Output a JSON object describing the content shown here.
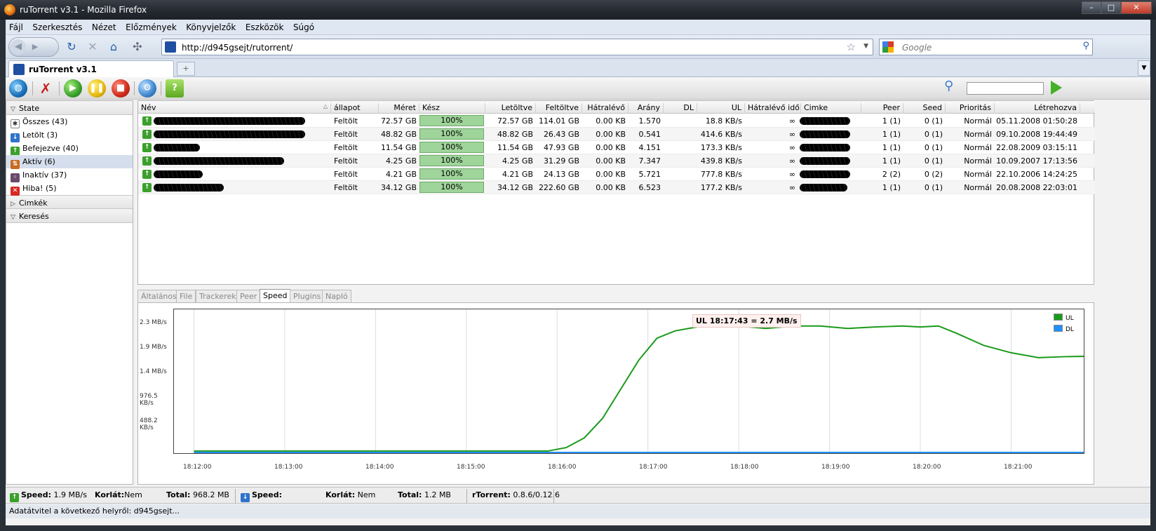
{
  "window": {
    "title": "ruTorrent v3.1 - Mozilla Firefox"
  },
  "menu": [
    "Fájl",
    "Szerkesztés",
    "Nézet",
    "Előzmények",
    "Könyvjelzők",
    "Eszközök",
    "Súgó"
  ],
  "nav": {
    "url": "http://d945gsejt/rutorrent/",
    "search_placeholder": "Google"
  },
  "browser_tab": {
    "label": "ruTorrent v3.1",
    "new_tab": "+"
  },
  "sidebar": {
    "state_header": "State",
    "items": [
      {
        "label": "Összes (43)",
        "icon": "all-icon"
      },
      {
        "label": "Letölt (3)",
        "icon": "download-icon"
      },
      {
        "label": "Befejezve (40)",
        "icon": "completed-icon"
      },
      {
        "label": "Aktív (6)",
        "icon": "active-icon"
      },
      {
        "label": "Inaktív (37)",
        "icon": "inactive-icon"
      },
      {
        "label": "Hiba! (5)",
        "icon": "error-icon"
      }
    ],
    "labels_header": "Cimkék",
    "search_header": "Keresés"
  },
  "list": {
    "columns": [
      "Név",
      "állapot",
      "Méret",
      "Kész",
      "Letöltve",
      "Feltöltve",
      "Hátralévő",
      "Arány",
      "DL",
      "UL",
      "Hátralévő idő",
      "Cimke",
      "Peer",
      "Seed",
      "Prioritás",
      "Létrehozva"
    ],
    "rows": [
      {
        "status": "Feltölt",
        "size": "72.57 GB",
        "done": "100%",
        "downloaded": "72.57 GB",
        "uploaded": "114.01 GB",
        "remaining": "0.00 KB",
        "ratio": "1.570",
        "dl": "",
        "ul": "18.8 KB/s",
        "eta": "∞",
        "peer": "1 (1)",
        "seed": "0 (1)",
        "priority": "Normál",
        "created": "05.11.2008 01:50:28"
      },
      {
        "status": "Feltölt",
        "size": "48.82 GB",
        "done": "100%",
        "downloaded": "48.82 GB",
        "uploaded": "26.43 GB",
        "remaining": "0.00 KB",
        "ratio": "0.541",
        "dl": "",
        "ul": "414.6 KB/s",
        "eta": "∞",
        "peer": "1 (1)",
        "seed": "0 (1)",
        "priority": "Normál",
        "created": "09.10.2008 19:44:49"
      },
      {
        "status": "Feltölt",
        "size": "11.54 GB",
        "done": "100%",
        "downloaded": "11.54 GB",
        "uploaded": "47.93 GB",
        "remaining": "0.00 KB",
        "ratio": "4.151",
        "dl": "",
        "ul": "173.3 KB/s",
        "eta": "∞",
        "peer": "1 (1)",
        "seed": "0 (1)",
        "priority": "Normál",
        "created": "22.08.2009 03:15:11"
      },
      {
        "status": "Feltölt",
        "size": "4.25 GB",
        "done": "100%",
        "downloaded": "4.25 GB",
        "uploaded": "31.29 GB",
        "remaining": "0.00 KB",
        "ratio": "7.347",
        "dl": "",
        "ul": "439.8 KB/s",
        "eta": "∞",
        "peer": "1 (1)",
        "seed": "0 (1)",
        "priority": "Normál",
        "created": "10.09.2007 17:13:56"
      },
      {
        "status": "Feltölt",
        "size": "4.21 GB",
        "done": "100%",
        "downloaded": "4.21 GB",
        "uploaded": "24.13 GB",
        "remaining": "0.00 KB",
        "ratio": "5.721",
        "dl": "",
        "ul": "777.8 KB/s",
        "eta": "∞",
        "peer": "2 (2)",
        "seed": "0 (2)",
        "priority": "Normál",
        "created": "22.10.2006 14:24:25"
      },
      {
        "status": "Feltölt",
        "size": "34.12 GB",
        "done": "100%",
        "downloaded": "34.12 GB",
        "uploaded": "222.60 GB",
        "remaining": "0.00 KB",
        "ratio": "6.523",
        "dl": "",
        "ul": "177.2 KB/s",
        "eta": "∞",
        "peer": "1 (1)",
        "seed": "0 (1)",
        "priority": "Normál",
        "created": "20.08.2008 22:03:01"
      }
    ]
  },
  "details_tabs": [
    "Általános",
    "File",
    "Trackerek",
    "Peer",
    "Speed",
    "Plugins",
    "Napló"
  ],
  "details_selected": "Speed",
  "chart_data": {
    "type": "line",
    "y_ticks": [
      "2.3 MB/s",
      "1.9 MB/s",
      "1.4 MB/s",
      "976.5 KB/s",
      "488.2 KB/s"
    ],
    "x_ticks": [
      "18:12:00",
      "18:13:00",
      "18:14:00",
      "18:15:00",
      "18:16:00",
      "18:17:00",
      "18:18:00",
      "18:19:00",
      "18:20:00",
      "18:21:00"
    ],
    "tooltip": "UL 18:17:43 = 2.7 MB/s",
    "ylim_mb": [
      0,
      2.9
    ],
    "series": [
      {
        "name": "UL",
        "color": "#1a9a1a",
        "points": [
          [
            0,
            0.03
          ],
          [
            3.9,
            0.03
          ],
          [
            4.1,
            0.1
          ],
          [
            4.3,
            0.3
          ],
          [
            4.5,
            0.7
          ],
          [
            4.7,
            1.3
          ],
          [
            4.9,
            1.9
          ],
          [
            5.1,
            2.35
          ],
          [
            5.3,
            2.5
          ],
          [
            5.6,
            2.6
          ],
          [
            5.75,
            2.7
          ],
          [
            5.85,
            2.65
          ],
          [
            6.0,
            2.6
          ],
          [
            6.3,
            2.55
          ],
          [
            6.6,
            2.6
          ],
          [
            6.9,
            2.6
          ],
          [
            7.2,
            2.55
          ],
          [
            7.5,
            2.58
          ],
          [
            7.8,
            2.6
          ],
          [
            8.0,
            2.58
          ],
          [
            8.2,
            2.6
          ],
          [
            8.4,
            2.45
          ],
          [
            8.7,
            2.2
          ],
          [
            9.0,
            2.05
          ],
          [
            9.3,
            1.95
          ],
          [
            9.6,
            1.97
          ],
          [
            9.9,
            1.98
          ],
          [
            10.1,
            2.05
          ]
        ]
      },
      {
        "name": "DL",
        "color": "#1e90ff",
        "points": [
          [
            0,
            0.0
          ],
          [
            10.1,
            0.0
          ]
        ]
      }
    ]
  },
  "status": {
    "ul_speed_label": "Speed:",
    "ul_speed": "1.9 MB/s",
    "ul_limit_label": "Korlát:",
    "ul_limit": "Nem",
    "ul_total_label": "Total:",
    "ul_total": "968.2 MB",
    "dl_speed_label": "Speed:",
    "dl_speed": "",
    "dl_limit_label": "Korlát:",
    "dl_limit": "Nem",
    "dl_total_label": "Total:",
    "dl_total": "1.2 MB",
    "version_label": "rTorrent:",
    "version": "0.8.6/0.12.6"
  },
  "ff_status": "Adatátvitel a következő helyről: d945gsejt..."
}
